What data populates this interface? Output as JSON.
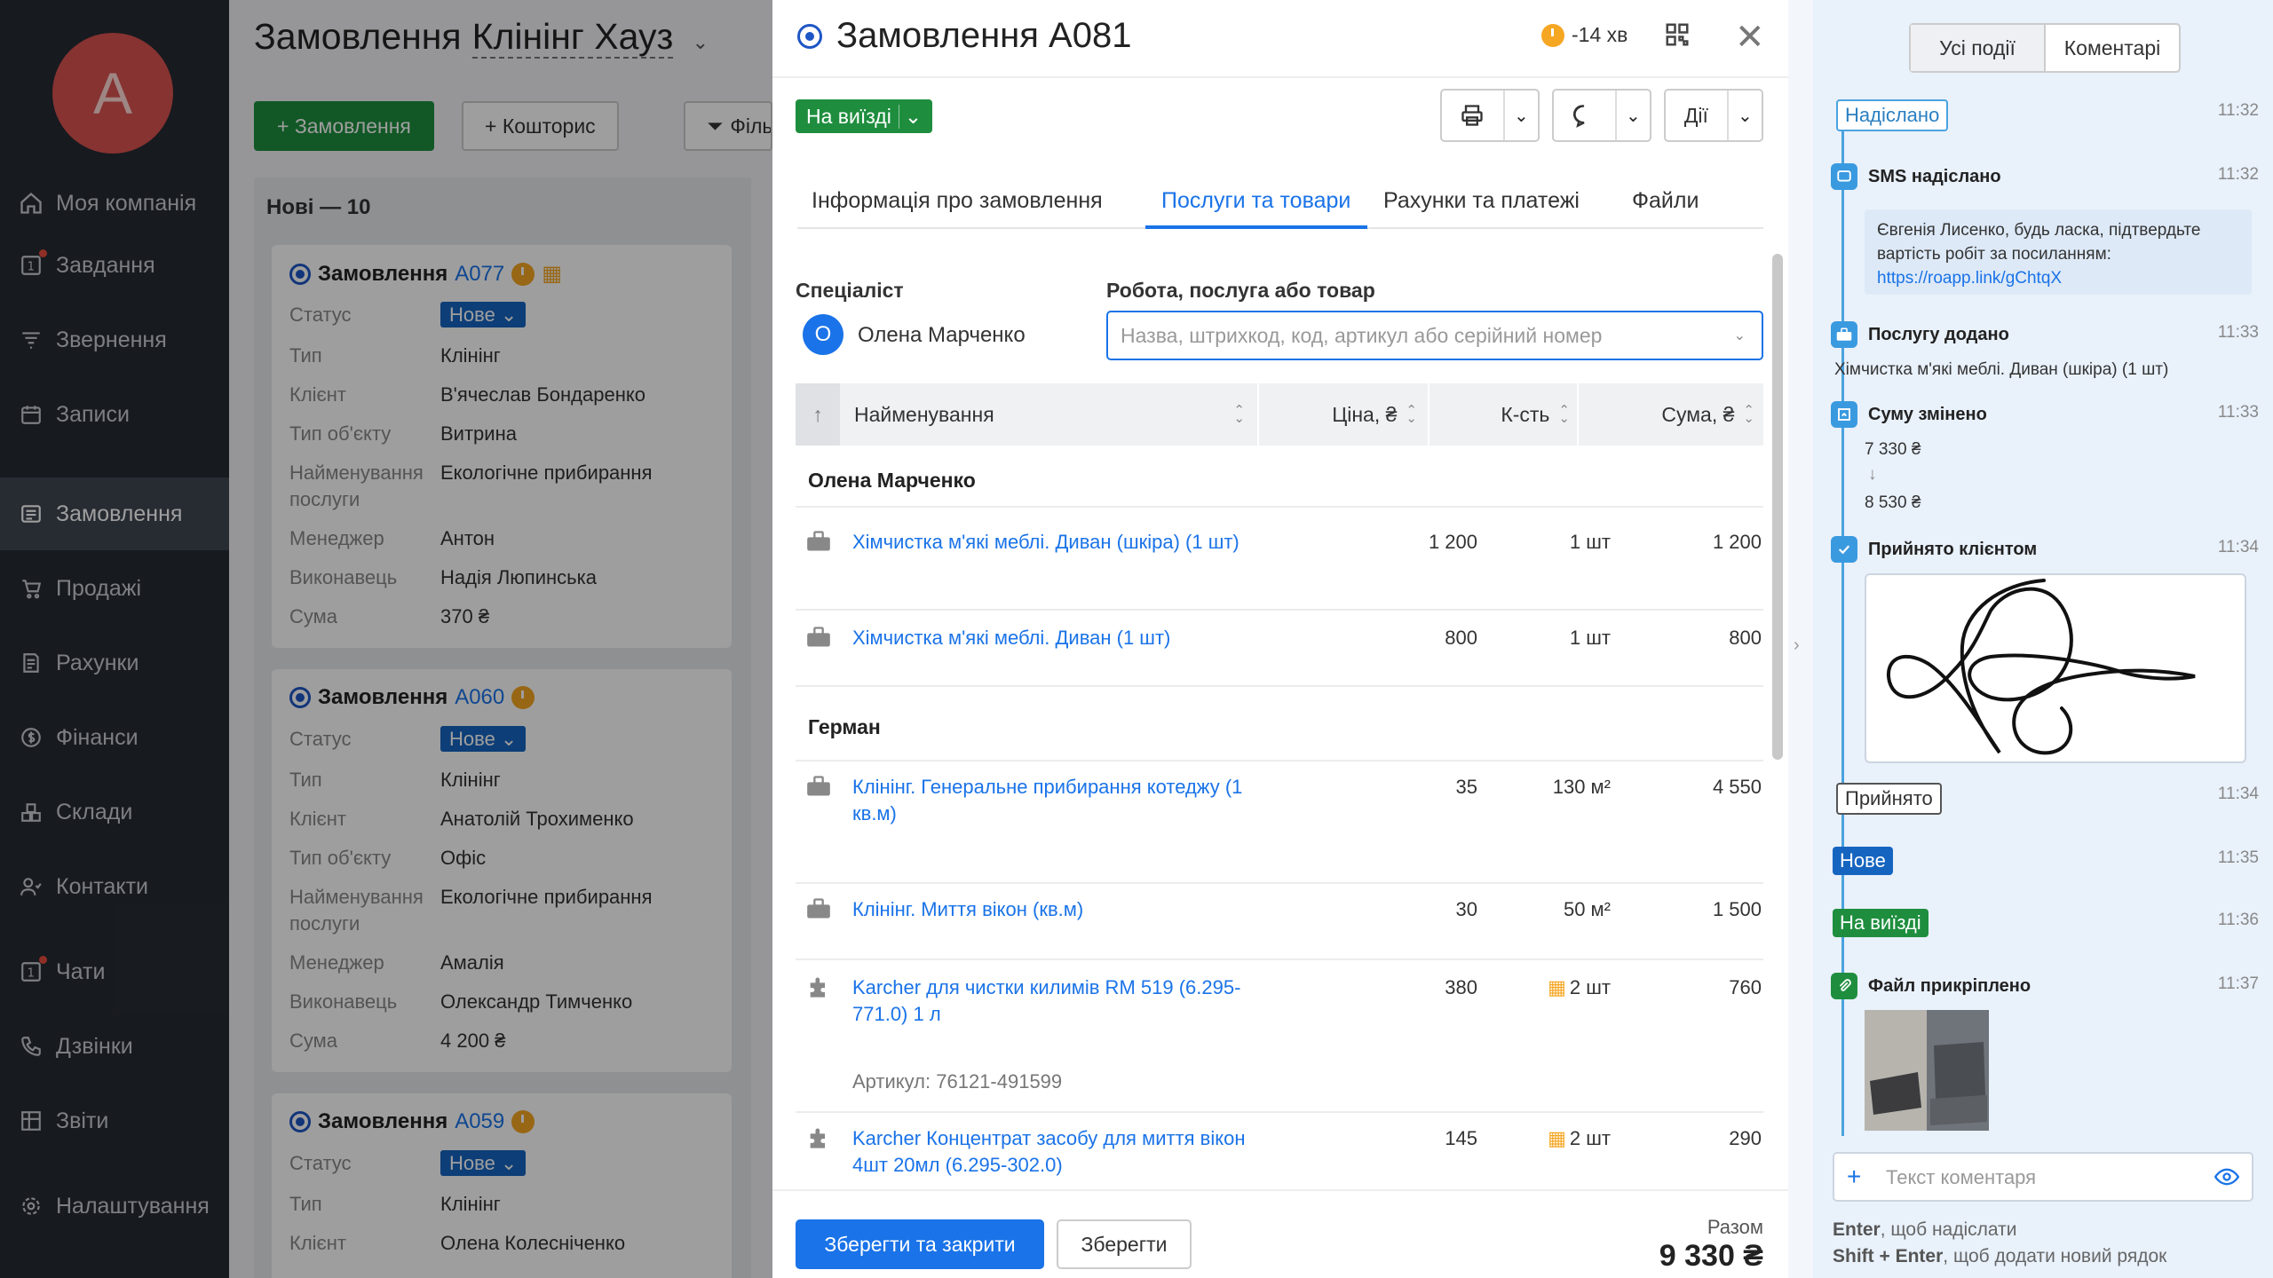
{
  "sidebar": {
    "avatar_letter": "A",
    "items": [
      {
        "label": "Моя компанія",
        "icon": "home-icon"
      },
      {
        "label": "Завдання",
        "icon": "tasks-icon",
        "badge": "1"
      },
      {
        "label": "Звернення",
        "icon": "funnel-icon"
      },
      {
        "label": "Записи",
        "icon": "calendar-icon"
      },
      {
        "label": "Замовлення",
        "icon": "orders-icon",
        "active": true
      },
      {
        "label": "Продажі",
        "icon": "cart-icon"
      },
      {
        "label": "Рахунки",
        "icon": "invoice-icon"
      },
      {
        "label": "Фінанси",
        "icon": "dollar-icon"
      },
      {
        "label": "Склади",
        "icon": "warehouse-icon"
      },
      {
        "label": "Контакти",
        "icon": "contacts-icon"
      },
      {
        "label": "Чати",
        "icon": "chat-icon",
        "badge": "1"
      },
      {
        "label": "Дзвінки",
        "icon": "phone-icon"
      },
      {
        "label": "Звіти",
        "icon": "reports-icon"
      },
      {
        "label": "Налаштування",
        "icon": "gear-icon"
      }
    ]
  },
  "board": {
    "title": "Замовлення",
    "company": "Клінінг Хауз",
    "add_order": "+ Замовлення",
    "add_estimate": "+ Кошторис",
    "filter": "Фільтр",
    "column_title": "Нові — 10",
    "field_labels": {
      "status": "Статус",
      "type": "Тип",
      "client": "Клієнт",
      "object_type": "Тип об'єкту",
      "service_name_1": "Найменування",
      "service_name_2": "послуги",
      "manager": "Менеджер",
      "performer": "Виконавець",
      "sum": "Сума"
    },
    "cards": [
      {
        "prefix": "Замовлення",
        "num": "A077",
        "status": "Нове",
        "type": "Клінінг",
        "client": "В'ячеслав Бондаренко",
        "object_type": "Витрина",
        "service": "Екологічне прибирання",
        "manager": "Антон",
        "performer": "Надія Люпинська",
        "sum": "370 ₴"
      },
      {
        "prefix": "Замовлення",
        "num": "A060",
        "status": "Нове",
        "type": "Клінінг",
        "client": "Анатолій Трохименко",
        "object_type": "Офіс",
        "service": "Екологічне прибирання",
        "manager": "Амалія",
        "performer": "Олександр Тимченко",
        "sum": "4 200 ₴"
      },
      {
        "prefix": "Замовлення",
        "num": "A059",
        "status": "Нове",
        "type": "Клінінг",
        "client": "Олена Колесніченко"
      }
    ]
  },
  "order": {
    "title": "Замовлення A081",
    "time": "-14 хв",
    "status": "На виїзді",
    "actions": "Дії",
    "tabs": [
      "Інформація про замовлення",
      "Послуги та товари",
      "Рахунки та платежі",
      "Файли"
    ],
    "specialist_label": "Спеціаліст",
    "specialist_initial": "О",
    "specialist_name": "Олена Марченко",
    "work_label": "Робота, послуга або товар",
    "search_placeholder": "Назва, штрихкод, код, артикул або серійний номер",
    "columns": {
      "name": "Найменування",
      "price": "Ціна, ₴",
      "qty": "К-сть",
      "sum": "Сума, ₴"
    },
    "groups": [
      {
        "name": "Олена Марченко",
        "items": [
          {
            "kind": "service",
            "name": "Хімчистка м'які меблі. Диван (шкіра) (1 шт)",
            "price": "1 200",
            "qty": "1 шт",
            "sum": "1 200"
          },
          {
            "kind": "service",
            "name": "Хімчистка м'які меблі. Диван (1 шт)",
            "price": "800",
            "qty": "1 шт",
            "sum": "800"
          }
        ]
      },
      {
        "name": "Герман",
        "items": [
          {
            "kind": "service",
            "name": "Клінінг. Генеральне прибирання котеджу (1 кв.м)",
            "price": "35",
            "qty": "130 м²",
            "sum": "4 550"
          },
          {
            "kind": "service",
            "name": "Клінінг. Миття вікон (кв.м)",
            "price": "30",
            "qty": "50 м²",
            "sum": "1 500"
          },
          {
            "kind": "product",
            "name": "Karcher для чистки килимів RM 519 (6.295-771.0) 1 л",
            "price": "380",
            "qty": "2 шт",
            "sum": "760",
            "sku": "Артикул: 76121-491599"
          },
          {
            "kind": "product",
            "name": "Karcher Концентрат засобу для миття вікон 4шт 20мл (6.295-302.0)",
            "price": "145",
            "qty": "2 шт",
            "sum": "290"
          }
        ]
      }
    ],
    "save_close": "Зберегти та закрити",
    "save": "Зберегти",
    "total_label": "Разом",
    "total_value": "9 330 ₴"
  },
  "events": {
    "tabs": [
      "Усі події",
      "Коментарі"
    ],
    "items": [
      {
        "kind": "chip",
        "label": "Надіслано",
        "time": "11:32"
      },
      {
        "kind": "event",
        "title": "SMS надіслано",
        "time": "11:32",
        "text1": "Євгенія Лисенко, будь ласка, підтвердьте",
        "text2": "вартість робіт за посиланням:",
        "link": "https://roapp.link/gChtqX"
      },
      {
        "kind": "event",
        "title": "Послугу додано",
        "time": "11:33",
        "text": "Хімчистка м'які меблі. Диван (шкіра) (1 шт)"
      },
      {
        "kind": "event",
        "title": "Суму змінено",
        "time": "11:33",
        "from": "7 330 ₴",
        "to": "8 530 ₴"
      },
      {
        "kind": "event",
        "title": "Прийнято клієнтом",
        "time": "11:34"
      },
      {
        "kind": "chip",
        "label": "Прийнято",
        "time": "11:34"
      },
      {
        "kind": "chip",
        "label": "Нове",
        "time": "11:35"
      },
      {
        "kind": "chip",
        "label": "На виїзді",
        "time": "11:36"
      },
      {
        "kind": "event",
        "title": "Файл прикріплено",
        "time": "11:37"
      }
    ],
    "comment_placeholder": "Текст коментаря",
    "hint1_key": "Enter",
    "hint1_text": ", щоб надіслати",
    "hint2_key": "Shift + Enter",
    "hint2_text": ", щоб додати новий рядок"
  },
  "colors": {
    "accent": "#1a73e8",
    "success": "#1e8e3e",
    "sidebar": "#262b33",
    "timeline": "#4aa3df"
  }
}
